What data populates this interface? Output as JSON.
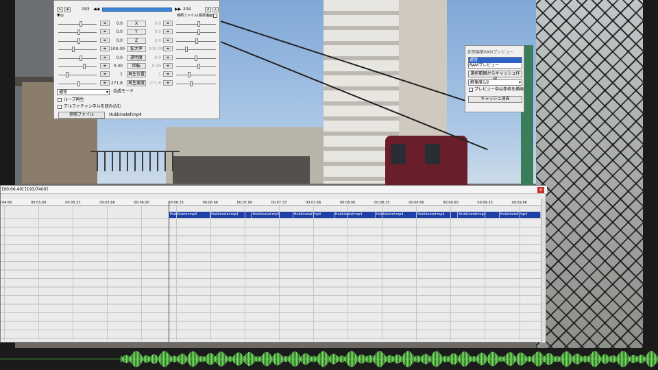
{
  "settings": {
    "frame_start": "193",
    "frame_end": "204",
    "source_file_label": "参照ファイル(標準描画)",
    "params": [
      {
        "value": "0.0",
        "label": "X",
        "end_value": "0.0"
      },
      {
        "value": "0.0",
        "label": "Y",
        "end_value": "0.0"
      },
      {
        "value": "0.0",
        "label": "Z",
        "end_value": "0.0"
      },
      {
        "value": "100.00",
        "label": "拡大率",
        "end_value": "100.00"
      },
      {
        "value": "0.0",
        "label": "透明度",
        "end_value": "0.0"
      },
      {
        "value": "0.00",
        "label": "回転",
        "end_value": "0.00"
      },
      {
        "value": "1",
        "label": "再生位置",
        "end_value": "1"
      },
      {
        "value": "271.8",
        "label": "再生速度",
        "end_value": "271.8"
      }
    ],
    "blend_mode": "通常",
    "blend_mode_label": "合成モード",
    "loop_label": "ループ再生",
    "alpha_label": "アルファチャンネルを読み込む",
    "ref_button_label": "参照ファイル",
    "file_name": "Hukkinetaf.mp4"
  },
  "cache": {
    "title": "拡張編集RAMプレビュー",
    "list": [
      "通常",
      "RAMプレビュー"
    ],
    "selected_index": 0,
    "create_button": "選択範囲からキャッシュ作成",
    "resolution": "解像度1/2",
    "draw_during_preview": "プレビュー中は赤枠を描画",
    "clear_button": "キャッシュ消去"
  },
  "timeline": {
    "title": "[00:06.40] [193/7400]",
    "close_glyph": "×",
    "ticks": [
      {
        "label": "00:04.66"
      },
      {
        "label": "00:05.00"
      },
      {
        "label": "00:05.33"
      },
      {
        "label": "00:05.66"
      },
      {
        "label": "00:06.00"
      },
      {
        "label": "00:06.33"
      },
      {
        "label": "00:06.66"
      },
      {
        "label": "00:07.00"
      },
      {
        "label": "00:07.33"
      },
      {
        "label": "00:07.66"
      },
      {
        "label": "00:08.00"
      },
      {
        "label": "00:08.33"
      },
      {
        "label": "00:08.66"
      },
      {
        "label": "00:09.00"
      },
      {
        "label": "00:09.33"
      },
      {
        "label": "00:09.66"
      }
    ],
    "clips": [
      "Hukkinetaf.mp4",
      "Hukkinetaf.mp4",
      "Hukkinetaf.mp4",
      "Hukkinetaf.mp4",
      "Hukkinetaf.mp4",
      "Hukkinetaf.mp4",
      "Hukkinetaf.mp4",
      "Hukkinetaf.mp4",
      "Hukkinetaf.mp4"
    ]
  },
  "colors": {
    "clip": "#1f3fa8",
    "waveform": "#6fe05a",
    "frame_bar": "#3b84d6"
  }
}
